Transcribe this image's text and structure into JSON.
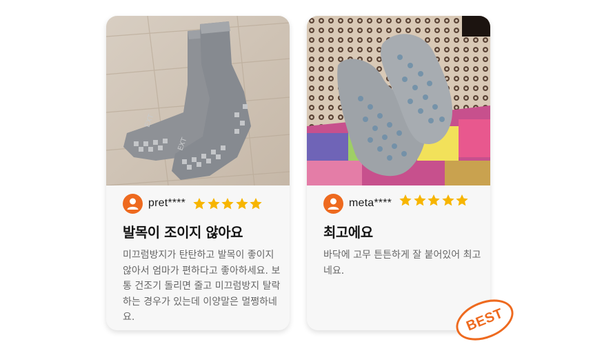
{
  "reviews": [
    {
      "photo_icon": "grey-socks-on-wood-floor-photo",
      "username": "pret****",
      "rating": 5,
      "title": "발목이 조이지 않아요",
      "body": "미끄럼방지가 탄탄하고 발목이 좋이지 않아서 엄마가 편하다고 좋아하세요. 보통 건조기 돌리면 줄고 미끄럼방지 탈락하는 경우가 있는데 이양말은 멀쩡하네요."
    },
    {
      "photo_icon": "grey-grip-socks-on-blanket-photo",
      "username": "meta****",
      "rating": 5,
      "title": "최고에요",
      "body": "바닥에 고무 튼튼하게 잘 붙어있어 최고네요."
    }
  ],
  "badge": {
    "label": "BEST"
  },
  "colors": {
    "accent": "#ee6a1f",
    "star": "#f7b500",
    "card": "#f7f7f7"
  }
}
